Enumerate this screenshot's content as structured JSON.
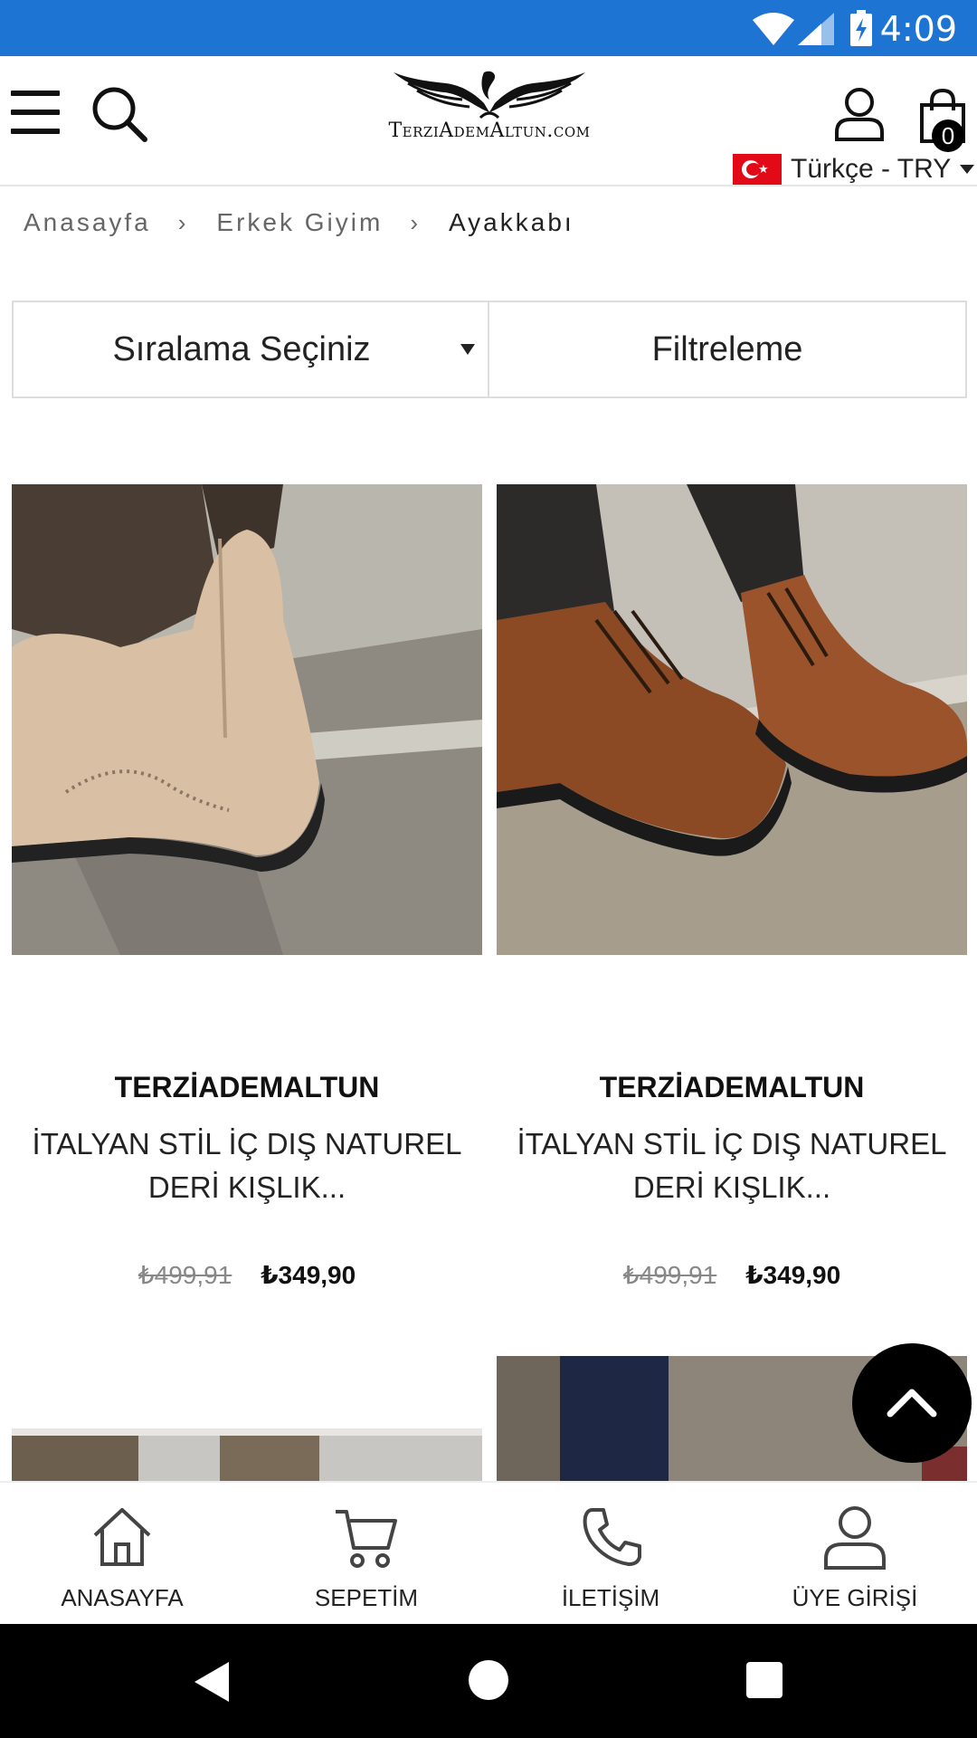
{
  "status_bar": {
    "time": "4:09"
  },
  "header": {
    "logo_text": "TerziAdemAltun.com",
    "cart_count": "0",
    "language": "Türkçe - TRY"
  },
  "breadcrumb": {
    "items": [
      "Anasayfa",
      "Erkek Giyim",
      "Ayakkabı"
    ],
    "separator": "›"
  },
  "controls": {
    "sort_label": "Sıralama Seçiniz",
    "filter_label": "Filtreleme"
  },
  "products": [
    {
      "brand": "TERZİADEMALTUN",
      "name": "İTALYAN STİL İÇ DIŞ NATUREL DERİ KIŞLIK...",
      "old_price": "₺499,91",
      "new_price": "₺349,90"
    },
    {
      "brand": "TERZİADEMALTUN",
      "name": "İTALYAN STİL İÇ DIŞ NATUREL DERİ KIŞLIK...",
      "old_price": "₺499,91",
      "new_price": "₺349,90"
    }
  ],
  "bottom_nav": {
    "items": [
      "ANASAYFA",
      "SEPETİM",
      "İLETİŞİM",
      "ÜYE GİRİŞİ"
    ]
  },
  "colors": {
    "status_bar": "#1e74d3",
    "flag_red": "#e30a17",
    "old_price": "#888888"
  },
  "icons": [
    "wifi-icon",
    "signal-icon",
    "battery-icon",
    "menu-icon",
    "search-icon",
    "user-icon",
    "cart-icon",
    "flag-tr-icon",
    "chevron-up-icon",
    "home-icon",
    "shopping-cart-icon",
    "phone-icon",
    "user-login-icon"
  ]
}
